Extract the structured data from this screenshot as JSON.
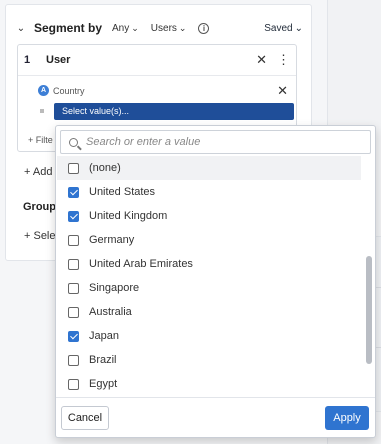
{
  "segment": {
    "title": "Segment by",
    "any_label": "Any",
    "users_label": "Users",
    "saved_label": "Saved",
    "info_glyph": "i"
  },
  "user_card": {
    "number": "1",
    "label": "User",
    "property": "Country",
    "select_value": "Select value(s)...",
    "filter_link": "+ Filte"
  },
  "background": {
    "add_link": "+ Add",
    "group_heading": "Group",
    "select_link": "+ Sele"
  },
  "dropdown": {
    "search_placeholder": "Search or enter a value",
    "options": [
      {
        "label": "(none)",
        "checked": false
      },
      {
        "label": "United States",
        "checked": true
      },
      {
        "label": "United Kingdom",
        "checked": true
      },
      {
        "label": "Germany",
        "checked": false
      },
      {
        "label": "United Arab Emirates",
        "checked": false
      },
      {
        "label": "Singapore",
        "checked": false
      },
      {
        "label": "Australia",
        "checked": false
      },
      {
        "label": "Japan",
        "checked": true
      },
      {
        "label": "Brazil",
        "checked": false
      },
      {
        "label": "Egypt",
        "checked": false
      }
    ],
    "cancel_label": "Cancel",
    "apply_label": "Apply"
  },
  "colors": {
    "accent": "#2f74d0",
    "select_bg": "#1f4e99"
  }
}
